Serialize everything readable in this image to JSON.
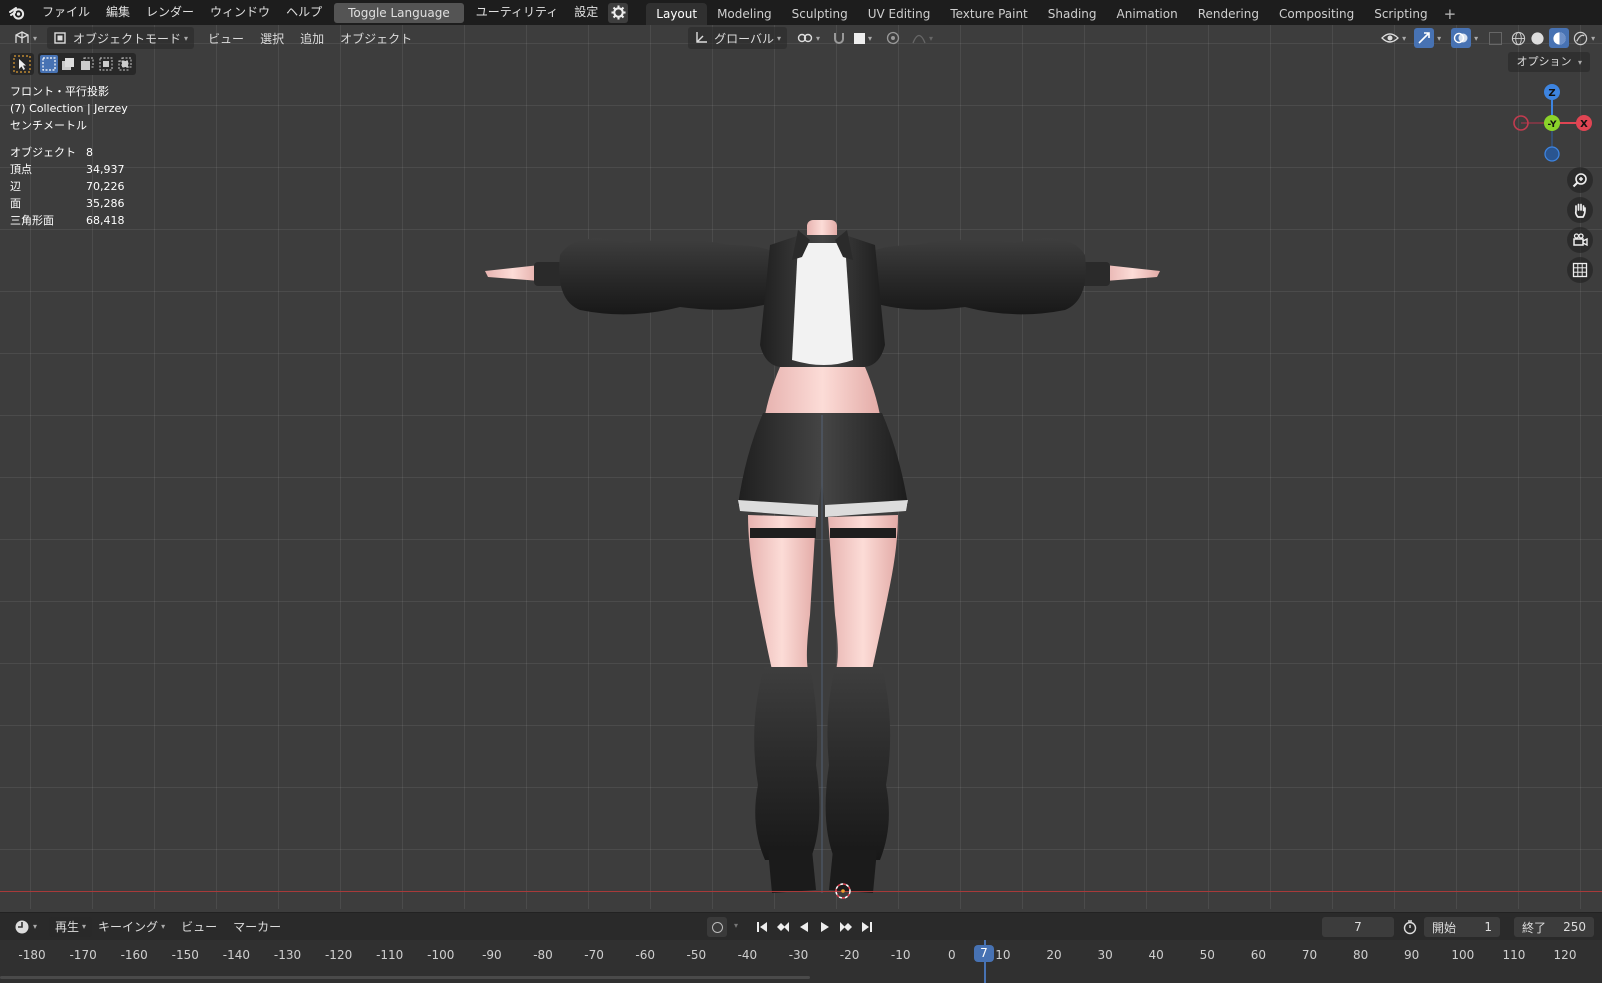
{
  "topbar": {
    "menus": [
      "ファイル",
      "編集",
      "レンダー",
      "ウィンドウ",
      "ヘルプ"
    ],
    "toggle_language": "Toggle Language",
    "utility": "ユーティリティ",
    "settings": "設定",
    "workspaces": [
      "Layout",
      "Modeling",
      "Sculpting",
      "UV Editing",
      "Texture Paint",
      "Shading",
      "Animation",
      "Rendering",
      "Compositing",
      "Scripting"
    ],
    "active_workspace": "Layout",
    "add_tab": "+"
  },
  "viewport_header": {
    "mode": "オブジェクトモード",
    "menus": [
      "ビュー",
      "選択",
      "追加",
      "オブジェクト"
    ],
    "transform_orientation": "グローバル",
    "options": "オプション"
  },
  "overlay": {
    "view_name": "フロント・平行投影",
    "collection": "(7) Collection | Jerzey",
    "units": "センチメートル",
    "stats": [
      {
        "label": "オブジェクト",
        "value": "8"
      },
      {
        "label": "頂点",
        "value": "34,937"
      },
      {
        "label": "辺",
        "value": "70,226"
      },
      {
        "label": "面",
        "value": "35,286"
      },
      {
        "label": "三角形面",
        "value": "68,418"
      }
    ]
  },
  "gizmo": {
    "z": "Z",
    "y": "-Y",
    "x": "X"
  },
  "timeline": {
    "menus": [
      "再生",
      "キーイング",
      "ビュー",
      "マーカー"
    ],
    "current_frame": "7",
    "start_label": "開始",
    "start_value": "1",
    "end_label": "終了",
    "end_value": "250",
    "ruler": [
      "-180",
      "-170",
      "-160",
      "-150",
      "-140",
      "-130",
      "-120",
      "-110",
      "-100",
      "-90",
      "-80",
      "-70",
      "-60",
      "-50",
      "-40",
      "-30",
      "-20",
      "-10",
      "0",
      "10",
      "20",
      "30",
      "40",
      "50",
      "60",
      "70",
      "80",
      "90",
      "100",
      "110",
      "120"
    ],
    "playhead": "7"
  },
  "colors": {
    "accent": "#4772b3",
    "x_axis": "#e04553",
    "y_axis": "#8bd32a",
    "z_axis": "#3d84e0"
  }
}
